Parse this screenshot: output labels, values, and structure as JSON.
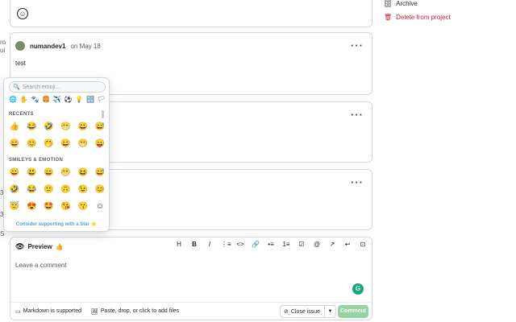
{
  "left_fragments": [
    "ro",
    "ui",
    "3",
    "3",
    "S"
  ],
  "top_card": {
    "reaction_icon": "smiley-icon"
  },
  "comments": [
    {
      "username": "numandev1",
      "date": "on May 18",
      "body": "test"
    }
  ],
  "menu_icon": "kebab-icon",
  "sidebar": {
    "archive_label": "Archive",
    "delete_label": "Delete from project"
  },
  "emoji_picker": {
    "search_placeholder": "Search emoji...",
    "categories": [
      "🌐",
      "✋",
      "🐾",
      "🍔",
      "✈️",
      "⚽",
      "💡",
      "🔣",
      "🏳"
    ],
    "recents_title": "RECENTS",
    "recents": [
      [
        "👍",
        "😂",
        "🤣",
        "😁",
        "😀",
        "😅"
      ],
      [
        "😄",
        "😊",
        "🤭",
        "😄",
        "😁",
        "😛"
      ]
    ],
    "smileys_title": "SMILEYS & EMOTION",
    "smileys": [
      [
        "😀",
        "😃",
        "😄",
        "😁",
        "😆",
        "😅"
      ],
      [
        "🤣",
        "😂",
        "🙂",
        "🙃",
        "😉",
        "😊"
      ],
      [
        "😇",
        "😍",
        "🤩",
        "😘",
        "😗",
        "☺"
      ]
    ],
    "support_text": "Consider supporting with a Star ⭐"
  },
  "editor": {
    "preview_label": "Preview",
    "preview_emoji": "👍",
    "tools": [
      "H",
      "B",
      "I",
      "⋮≡",
      "<>",
      "🔗",
      "•≡",
      "1≡",
      "☑",
      "@",
      "↗",
      "↩",
      "⊡"
    ],
    "placeholder": "Leave a comment",
    "grammarly_badge": "G",
    "markdown_label": "Markdown is supported",
    "paste_label": "Paste, drop, or click to add files",
    "close_issue_label": "Close issue",
    "comment_label": "Comment"
  }
}
